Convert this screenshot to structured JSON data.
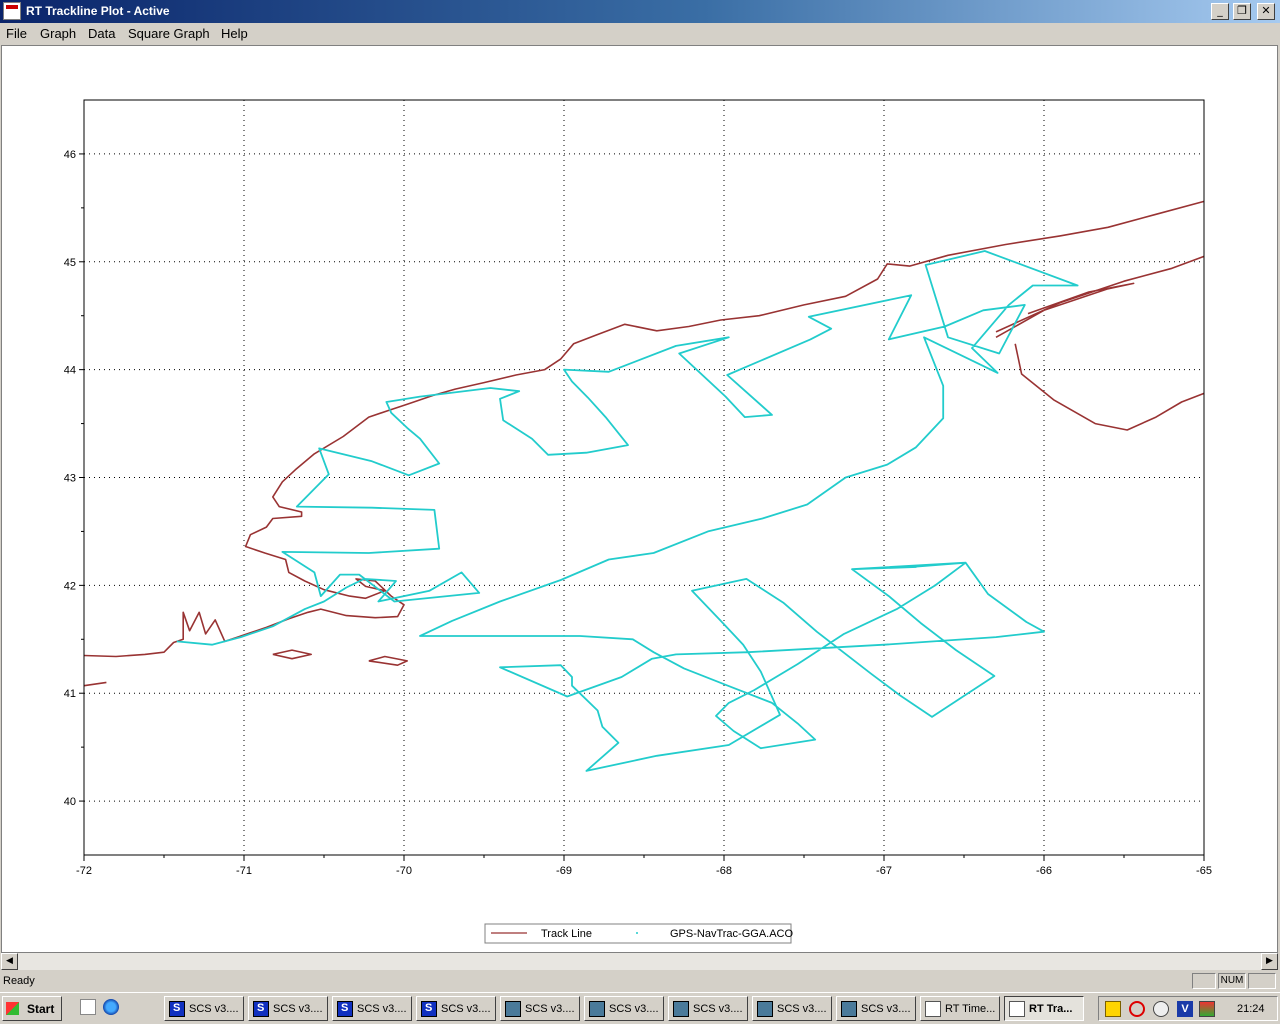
{
  "window": {
    "title": "RT Trackline Plot - Active"
  },
  "menu": {
    "items": [
      "File",
      "Graph",
      "Data",
      "Square Graph",
      "Help"
    ]
  },
  "status": {
    "text": "Ready",
    "num": "NUM"
  },
  "taskbar": {
    "start_label": "Start",
    "clock": "21:24",
    "buttons": [
      {
        "label": "SCS v3....",
        "icon": "scs-icon"
      },
      {
        "label": "SCS v3....",
        "icon": "scs-icon"
      },
      {
        "label": "SCS v3....",
        "icon": "scs-icon"
      },
      {
        "label": "SCS v3....",
        "icon": "scs-icon"
      },
      {
        "label": "SCS v3....",
        "icon": "network-icon"
      },
      {
        "label": "SCS v3....",
        "icon": "network-icon"
      },
      {
        "label": "SCS v3....",
        "icon": "network-icon"
      },
      {
        "label": "SCS v3....",
        "icon": "network-icon"
      },
      {
        "label": "SCS v3....",
        "icon": "network-icon"
      },
      {
        "label": "RT Time...",
        "icon": "doc-icon"
      },
      {
        "label": "RT Tra...",
        "icon": "doc-icon",
        "active": true
      }
    ]
  },
  "chart_data": {
    "type": "line",
    "xlim": [
      -72,
      -65
    ],
    "ylim": [
      39.5,
      46.5
    ],
    "xticks": [
      -72,
      -71,
      -70,
      -69,
      -68,
      -67,
      -66,
      -65
    ],
    "yticks": [
      40,
      41,
      42,
      43,
      44,
      45,
      46
    ],
    "xtick_labels": [
      "-72",
      "-71",
      "-70",
      "-69",
      "-68",
      "-67",
      "-66",
      "-65"
    ],
    "ytick_labels": [
      "40",
      "41",
      "42",
      "43",
      "44",
      "45",
      "46"
    ],
    "grid": true,
    "legend_position": "bottom-center",
    "series": [
      {
        "name": "Track Line",
        "color": "#993333",
        "kind": "coastline",
        "segments": [
          [
            [
              -72.0,
              41.35
            ],
            [
              -71.8,
              41.34
            ],
            [
              -71.62,
              41.36
            ],
            [
              -71.5,
              41.38
            ],
            [
              -71.44,
              41.47
            ],
            [
              -71.38,
              41.5
            ],
            [
              -71.38,
              41.75
            ],
            [
              -71.34,
              41.58
            ],
            [
              -71.28,
              41.75
            ],
            [
              -71.24,
              41.55
            ],
            [
              -71.18,
              41.68
            ],
            [
              -71.12,
              41.48
            ],
            [
              -71.04,
              41.52
            ],
            [
              -70.96,
              41.56
            ],
            [
              -70.86,
              41.61
            ],
            [
              -70.72,
              41.69
            ],
            [
              -70.6,
              41.75
            ],
            [
              -70.52,
              41.78
            ],
            [
              -70.36,
              41.72
            ],
            [
              -70.18,
              41.7
            ],
            [
              -70.04,
              41.71
            ],
            [
              -70.0,
              41.82
            ],
            [
              -70.08,
              41.9
            ],
            [
              -70.18,
              42.04
            ],
            [
              -70.3,
              42.06
            ],
            [
              -70.24,
              41.99
            ],
            [
              -70.12,
              41.95
            ],
            [
              -70.24,
              41.88
            ],
            [
              -70.34,
              41.9
            ],
            [
              -70.5,
              41.96
            ],
            [
              -70.62,
              42.04
            ],
            [
              -70.72,
              42.12
            ],
            [
              -70.74,
              42.24
            ],
            [
              -70.87,
              42.3
            ],
            [
              -70.99,
              42.36
            ],
            [
              -70.96,
              42.47
            ],
            [
              -70.86,
              42.54
            ],
            [
              -70.82,
              42.62
            ],
            [
              -70.64,
              42.64
            ],
            [
              -70.64,
              42.68
            ],
            [
              -70.78,
              42.73
            ],
            [
              -70.82,
              42.82
            ],
            [
              -70.76,
              42.96
            ],
            [
              -70.68,
              43.07
            ],
            [
              -70.56,
              43.22
            ],
            [
              -70.38,
              43.38
            ],
            [
              -70.22,
              43.56
            ],
            [
              -70.1,
              43.62
            ],
            [
              -69.98,
              43.68
            ],
            [
              -69.82,
              43.76
            ],
            [
              -69.68,
              43.82
            ],
            [
              -69.5,
              43.88
            ],
            [
              -69.3,
              43.95
            ],
            [
              -69.12,
              44.0
            ],
            [
              -69.02,
              44.1
            ],
            [
              -68.94,
              44.24
            ],
            [
              -68.8,
              44.32
            ],
            [
              -68.62,
              44.42
            ],
            [
              -68.42,
              44.36
            ],
            [
              -68.22,
              44.4
            ],
            [
              -68.02,
              44.46
            ],
            [
              -67.78,
              44.5
            ],
            [
              -67.5,
              44.6
            ],
            [
              -67.24,
              44.68
            ],
            [
              -67.04,
              44.84
            ],
            [
              -66.98,
              44.98
            ],
            [
              -66.84,
              44.96
            ],
            [
              -66.6,
              45.06
            ],
            [
              -66.24,
              45.16
            ],
            [
              -65.9,
              45.24
            ],
            [
              -65.6,
              45.32
            ],
            [
              -65.3,
              45.44
            ],
            [
              -65.0,
              45.56
            ]
          ],
          [
            [
              -72.0,
              41.07
            ],
            [
              -71.86,
              41.1
            ]
          ],
          [
            [
              -70.82,
              41.36
            ],
            [
              -70.7,
              41.32
            ],
            [
              -70.58,
              41.36
            ],
            [
              -70.7,
              41.4
            ],
            [
              -70.82,
              41.36
            ]
          ],
          [
            [
              -70.22,
              41.3
            ],
            [
              -70.04,
              41.26
            ],
            [
              -69.98,
              41.3
            ],
            [
              -70.12,
              41.34
            ],
            [
              -70.22,
              41.3
            ]
          ],
          [
            [
              -66.3,
              44.3
            ],
            [
              -66.0,
              44.55
            ],
            [
              -65.6,
              44.75
            ],
            [
              -65.44,
              44.8
            ],
            [
              -65.72,
              44.72
            ],
            [
              -66.1,
              44.52
            ]
          ],
          [
            [
              -66.18,
              44.24
            ],
            [
              -66.14,
              43.96
            ],
            [
              -65.94,
              43.72
            ],
            [
              -65.68,
              43.5
            ],
            [
              -65.48,
              43.44
            ],
            [
              -65.3,
              43.56
            ],
            [
              -65.14,
              43.7
            ],
            [
              -65.0,
              43.78
            ]
          ],
          [
            [
              -66.3,
              44.35
            ],
            [
              -65.9,
              44.62
            ],
            [
              -65.5,
              44.82
            ],
            [
              -65.2,
              44.94
            ],
            [
              -65.0,
              45.05
            ]
          ]
        ]
      },
      {
        "name": "GPS-NavTrac-GGA.ACO",
        "color": "#22cccc",
        "kind": "track",
        "points": [
          [
            -71.42,
            41.48
          ],
          [
            -71.2,
            41.45
          ],
          [
            -71.02,
            41.52
          ],
          [
            -70.82,
            41.62
          ],
          [
            -70.62,
            41.78
          ],
          [
            -70.5,
            41.85
          ],
          [
            -70.36,
            41.98
          ],
          [
            -70.25,
            42.06
          ],
          [
            -70.05,
            42.04
          ],
          [
            -70.16,
            41.85
          ],
          [
            -69.84,
            41.95
          ],
          [
            -69.64,
            42.12
          ],
          [
            -69.53,
            41.93
          ],
          [
            -70.06,
            41.85
          ],
          [
            -70.28,
            42.1
          ],
          [
            -70.4,
            42.1
          ],
          [
            -70.52,
            41.9
          ],
          [
            -70.56,
            42.12
          ],
          [
            -70.76,
            42.31
          ],
          [
            -70.22,
            42.3
          ],
          [
            -69.78,
            42.34
          ],
          [
            -69.81,
            42.7
          ],
          [
            -70.2,
            42.72
          ],
          [
            -70.67,
            42.73
          ],
          [
            -70.47,
            43.03
          ],
          [
            -70.53,
            43.27
          ],
          [
            -70.2,
            43.15
          ],
          [
            -69.97,
            43.02
          ],
          [
            -69.78,
            43.13
          ],
          [
            -69.9,
            43.36
          ],
          [
            -69.98,
            43.46
          ],
          [
            -70.08,
            43.6
          ],
          [
            -70.11,
            43.7
          ],
          [
            -69.9,
            43.75
          ],
          [
            -69.46,
            43.83
          ],
          [
            -69.28,
            43.8
          ],
          [
            -69.4,
            43.73
          ],
          [
            -69.38,
            43.53
          ],
          [
            -69.2,
            43.36
          ],
          [
            -69.1,
            43.21
          ],
          [
            -68.86,
            43.23
          ],
          [
            -68.6,
            43.3
          ],
          [
            -68.74,
            43.56
          ],
          [
            -68.85,
            43.74
          ],
          [
            -68.95,
            43.89
          ],
          [
            -69.0,
            44.0
          ],
          [
            -68.72,
            43.98
          ],
          [
            -68.3,
            44.22
          ],
          [
            -67.97,
            44.3
          ],
          [
            -68.28,
            44.15
          ],
          [
            -67.99,
            43.75
          ],
          [
            -67.87,
            43.56
          ],
          [
            -67.7,
            43.58
          ],
          [
            -67.98,
            43.95
          ],
          [
            -67.46,
            44.28
          ],
          [
            -67.33,
            44.38
          ],
          [
            -67.47,
            44.49
          ],
          [
            -66.83,
            44.69
          ],
          [
            -66.97,
            44.28
          ],
          [
            -66.62,
            44.4
          ],
          [
            -66.38,
            44.55
          ],
          [
            -66.12,
            44.6
          ],
          [
            -66.28,
            44.15
          ],
          [
            -66.6,
            44.3
          ],
          [
            -66.74,
            44.97
          ],
          [
            -66.37,
            45.1
          ],
          [
            -65.79,
            44.78
          ],
          [
            -66.07,
            44.78
          ],
          [
            -66.22,
            44.6
          ],
          [
            -66.45,
            44.2
          ],
          [
            -66.29,
            43.97
          ],
          [
            -66.75,
            44.3
          ],
          [
            -66.63,
            43.85
          ],
          [
            -66.63,
            43.55
          ],
          [
            -66.8,
            43.28
          ],
          [
            -66.98,
            43.12
          ],
          [
            -67.24,
            43.0
          ],
          [
            -67.48,
            42.75
          ],
          [
            -67.76,
            42.62
          ],
          [
            -68.1,
            42.5
          ],
          [
            -68.44,
            42.3
          ],
          [
            -68.72,
            42.24
          ],
          [
            -69.02,
            42.05
          ],
          [
            -69.4,
            41.85
          ],
          [
            -69.7,
            41.67
          ],
          [
            -69.9,
            41.53
          ],
          [
            -68.9,
            41.53
          ],
          [
            -68.57,
            41.5
          ],
          [
            -68.44,
            41.38
          ],
          [
            -68.25,
            41.23
          ],
          [
            -67.96,
            41.06
          ],
          [
            -67.7,
            40.91
          ],
          [
            -67.54,
            40.72
          ],
          [
            -67.43,
            40.57
          ],
          [
            -67.77,
            40.49
          ],
          [
            -67.94,
            40.65
          ],
          [
            -68.05,
            40.79
          ],
          [
            -67.97,
            40.91
          ],
          [
            -67.81,
            41.03
          ],
          [
            -67.54,
            41.27
          ],
          [
            -67.25,
            41.55
          ],
          [
            -66.92,
            41.78
          ],
          [
            -66.68,
            42.0
          ],
          [
            -66.49,
            42.21
          ],
          [
            -66.83,
            42.17
          ],
          [
            -66.8,
            42.17
          ],
          [
            -67.2,
            42.15
          ],
          [
            -66.97,
            41.9
          ],
          [
            -66.77,
            41.65
          ],
          [
            -66.55,
            41.4
          ],
          [
            -66.31,
            41.16
          ],
          [
            -66.7,
            40.78
          ],
          [
            -66.9,
            40.98
          ],
          [
            -67.08,
            41.18
          ],
          [
            -67.42,
            41.57
          ],
          [
            -67.63,
            41.84
          ],
          [
            -67.86,
            42.06
          ],
          [
            -68.2,
            41.95
          ],
          [
            -68.02,
            41.67
          ],
          [
            -67.88,
            41.45
          ],
          [
            -67.77,
            41.2
          ],
          [
            -67.65,
            40.8
          ],
          [
            -67.97,
            40.52
          ],
          [
            -68.42,
            40.42
          ],
          [
            -68.86,
            40.28
          ],
          [
            -68.66,
            40.54
          ],
          [
            -68.76,
            40.69
          ],
          [
            -68.79,
            40.84
          ],
          [
            -68.95,
            41.07
          ],
          [
            -68.95,
            41.15
          ],
          [
            -69.02,
            41.26
          ],
          [
            -69.4,
            41.24
          ],
          [
            -68.98,
            40.97
          ],
          [
            -68.64,
            41.15
          ],
          [
            -68.45,
            41.32
          ],
          [
            -68.3,
            41.36
          ],
          [
            -67.85,
            41.38
          ],
          [
            -67.0,
            41.45
          ],
          [
            -66.3,
            41.52
          ],
          [
            -66.0,
            41.57
          ],
          [
            -66.11,
            41.66
          ],
          [
            -66.35,
            41.92
          ],
          [
            -66.49,
            42.21
          ],
          [
            -67.2,
            42.15
          ]
        ]
      }
    ]
  }
}
